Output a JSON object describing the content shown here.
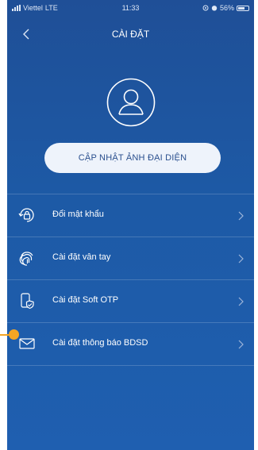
{
  "status_bar": {
    "carrier": "Viettel",
    "network": "LTE",
    "time": "11:33",
    "battery": "56%"
  },
  "header": {
    "title": "CÀI ĐẶT",
    "back_icon": "chevron-left-icon"
  },
  "profile": {
    "avatar_icon": "user-avatar-icon",
    "update_button_label": "CẬP NHẬT ẢNH ĐẠI DIỆN"
  },
  "menu": {
    "items": [
      {
        "label": "Đổi mật khẩu",
        "icon": "lock-refresh-icon"
      },
      {
        "label": "Cài đặt vân tay",
        "icon": "fingerprint-icon"
      },
      {
        "label": "Cài đặt Soft OTP",
        "icon": "phone-shield-icon"
      },
      {
        "label": "Cài đặt thông báo BDSD",
        "icon": "envelope-icon"
      }
    ]
  },
  "colors": {
    "background_top": "#1f4f97",
    "background_bottom": "#1f5fb0",
    "marker": "#f5a623",
    "button_bg": "#eef3fb",
    "button_text": "#2a4f8e"
  }
}
